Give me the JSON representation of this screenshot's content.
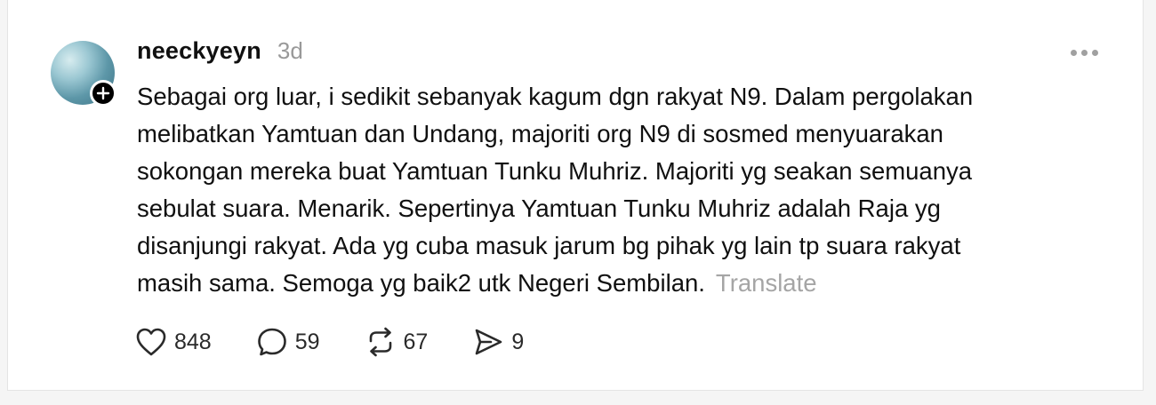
{
  "post": {
    "username": "neeckyeyn",
    "timestamp": "3d",
    "text_lines": [
      "Sebagai org luar, i sedikit sebanyak kagum dgn rakyat N9. Dalam pergolakan",
      "melibatkan Yamtuan dan Undang, majoriti org N9 di sosmed menyuarakan",
      "sokongan mereka buat Yamtuan Tunku Muhriz. Majoriti yg seakan semuanya",
      "sebulat suara. Menarik. Sepertinya Yamtuan Tunku Muhriz adalah Raja yg",
      "disanjungi rakyat. Ada yg cuba masuk jarum bg pihak yg lain tp suara rakyat",
      "masih sama. Semoga yg baik2 utk Negeri Sembilan."
    ],
    "translate_label": "Translate",
    "actions": {
      "likes": "848",
      "replies": "59",
      "reposts": "67",
      "shares": "9"
    },
    "icons": {
      "avatar": "avatar-image",
      "follow": "plus-icon",
      "more": "more-horizontal-icon",
      "like": "heart-icon",
      "reply": "speech-bubble-icon",
      "repost": "repost-icon",
      "share": "send-icon"
    }
  }
}
